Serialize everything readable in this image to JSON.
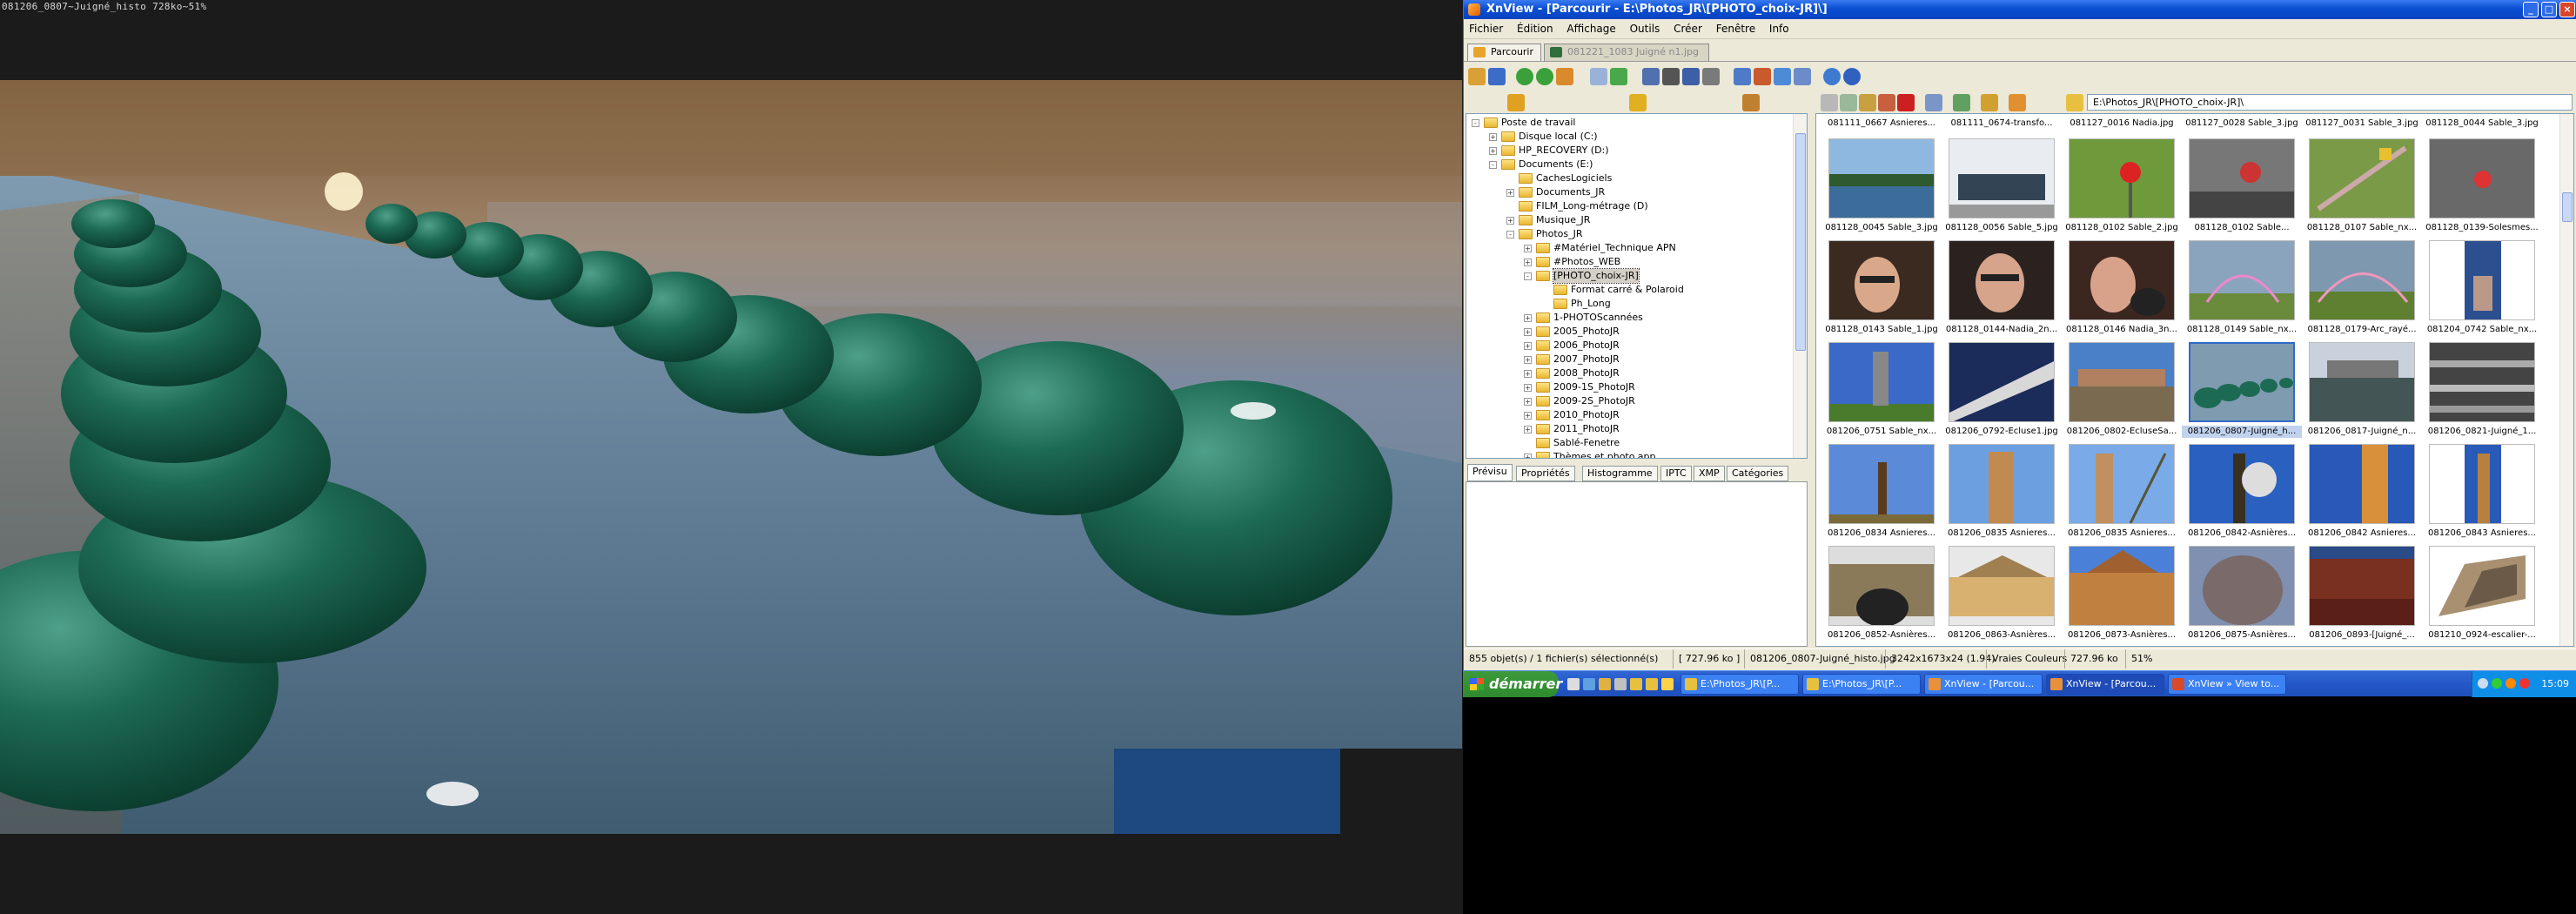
{
  "viewer": {
    "title": "081206_0807~Juigné_histo 728ko~51%"
  },
  "window": {
    "title": "XnView - [Parcourir - E:\\Photos_JR\\[PHOTO_choix-JR]\\]"
  },
  "menu": [
    "Fichier",
    "Édition",
    "Affichage",
    "Outils",
    "Créer",
    "Fenêtre",
    "Info"
  ],
  "tabs": [
    {
      "label": "Parcourir",
      "active": true
    },
    {
      "label": "081221_1083 Juigné n1.jpg",
      "active": false
    }
  ],
  "address": "E:\\Photos_JR\\[PHOTO_choix-JR]\\",
  "folders": [
    {
      "label": "Poste de travail",
      "level": 0,
      "exp": "-"
    },
    {
      "label": "Disque local (C:)",
      "level": 1,
      "exp": "+"
    },
    {
      "label": "HP_RECOVERY (D:)",
      "level": 1,
      "exp": "+"
    },
    {
      "label": "Documents (E:)",
      "level": 1,
      "exp": "-"
    },
    {
      "label": "CachesLogiciels",
      "level": 2,
      "exp": ""
    },
    {
      "label": "Documents_JR",
      "level": 2,
      "exp": "+"
    },
    {
      "label": "FILM_Long-métrage (D)",
      "level": 2,
      "exp": ""
    },
    {
      "label": "Musique_JR",
      "level": 2,
      "exp": "+"
    },
    {
      "label": "Photos_JR",
      "level": 2,
      "exp": "-"
    },
    {
      "label": "#Matériel_Technique APN",
      "level": 3,
      "exp": "+"
    },
    {
      "label": "#Photos_WEB",
      "level": 3,
      "exp": "+"
    },
    {
      "label": "[PHOTO_choix-JR]",
      "level": 3,
      "exp": "-",
      "selected": true
    },
    {
      "label": "Format carré & Polaroid",
      "level": 4,
      "exp": ""
    },
    {
      "label": "Ph_Long",
      "level": 4,
      "exp": ""
    },
    {
      "label": "1-PHOTOScannées",
      "level": 3,
      "exp": "+"
    },
    {
      "label": "2005_PhotoJR",
      "level": 3,
      "exp": "+"
    },
    {
      "label": "2006_PhotoJR",
      "level": 3,
      "exp": "+"
    },
    {
      "label": "2007_PhotoJR",
      "level": 3,
      "exp": "+"
    },
    {
      "label": "2008_PhotoJR",
      "level": 3,
      "exp": "+"
    },
    {
      "label": "2009-1S_PhotoJR",
      "level": 3,
      "exp": "+"
    },
    {
      "label": "2009-2S_PhotoJR",
      "level": 3,
      "exp": "+"
    },
    {
      "label": "2010_PhotoJR",
      "level": 3,
      "exp": "+"
    },
    {
      "label": "2011_PhotoJR",
      "level": 3,
      "exp": "+"
    },
    {
      "label": "Sablé-Fenetre",
      "level": 3,
      "exp": ""
    },
    {
      "label": "Thèmes et photo.app",
      "level": 3,
      "exp": "+"
    }
  ],
  "panel_tabs": [
    "Prévisu",
    "Propriétés",
    "Histogramme",
    "IPTC",
    "XMP",
    "Catégories"
  ],
  "top_row": [
    "081111_0667 Asnieres...",
    "081111_0674-transfo...",
    "081127_0016 Nadia.jpg",
    "081127_0028 Sable_3.jpg",
    "081127_0031 Sable_3.jpg",
    "081128_0044 Sable_3.jpg"
  ],
  "thumbnails": [
    {
      "caption": "081128_0045 Sable_3.jpg",
      "kind": "river"
    },
    {
      "caption": "081128_0056 Sable_5.jpg",
      "kind": "car"
    },
    {
      "caption": "081128_0102 Sable_2.jpg",
      "kind": "sign"
    },
    {
      "caption": "081128_0102 Sable...",
      "kind": "bwsign"
    },
    {
      "caption": "081128_0107 Sable_nx...",
      "kind": "bench"
    },
    {
      "caption": "081128_0139-Solesmes...",
      "kind": "bwred"
    },
    {
      "caption": "081128_0143 Sable_1.jpg",
      "kind": "face"
    },
    {
      "caption": "081128_0144-Nadia_2n...",
      "kind": "face2"
    },
    {
      "caption": "081128_0146 Nadia_3n...",
      "kind": "face3"
    },
    {
      "caption": "081128_0149 Sable_nx...",
      "kind": "rainbow"
    },
    {
      "caption": "081128_0179-Arc_rayé...",
      "kind": "rainbow2"
    },
    {
      "caption": "081204_0742 Sable_nx...",
      "kind": "tall"
    },
    {
      "caption": "081206_0751 Sable_nx...",
      "kind": "tower"
    },
    {
      "caption": "081206_0792-Ecluse1.jpg",
      "kind": "diag"
    },
    {
      "caption": "081206_0802-EcluseSa...",
      "kind": "lock"
    },
    {
      "caption": "081206_0807-Juigné_h...",
      "kind": "balls",
      "selected": true
    },
    {
      "caption": "081206_0817-Juigné_n...",
      "kind": "water"
    },
    {
      "caption": "081206_0821-Juigné_1...",
      "kind": "bwwater"
    },
    {
      "caption": "081206_0834 Asnieres...",
      "kind": "tree"
    },
    {
      "caption": "081206_0835 Asnieres...",
      "kind": "column"
    },
    {
      "caption": "081206_0835 Asnieres...",
      "kind": "tree2"
    },
    {
      "caption": "081206_0842-Asnières...",
      "kind": "tree3"
    },
    {
      "caption": "081206_0842 Asnieres...",
      "kind": "column2"
    },
    {
      "caption": "081206_0843 Asnieres...",
      "kind": "column3"
    },
    {
      "caption": "081206_0852-Asnières...",
      "kind": "bridge"
    },
    {
      "caption": "081206_0863-Asnières...",
      "kind": "manor"
    },
    {
      "caption": "081206_0873-Asnières...",
      "kind": "manor2"
    },
    {
      "caption": "081206_0875-Asnières...",
      "kind": "stone"
    },
    {
      "caption": "081206_0893-[Juigné_...",
      "kind": "brick"
    },
    {
      "caption": "081210_0924-escalier-...",
      "kind": "stairs"
    }
  ],
  "status": [
    "855 objet(s) / 1 fichier(s) sélectionné(s)",
    "[ 727.96 ko ]",
    "081206_0807-Juigné_histo.jpg",
    "3242x1673x24 (1.94)",
    "Vraies Couleurs",
    "727.96 ko",
    "51%"
  ],
  "taskbar": {
    "start": "démarrer",
    "tasks": [
      {
        "label": "E:\\Photos_JR\\[P...",
        "active": false
      },
      {
        "label": "E:\\Photos_JR\\[P...",
        "active": false
      },
      {
        "label": "XnView - [Parcou...",
        "active": false
      },
      {
        "label": "XnView - [Parcou...",
        "active": true
      },
      {
        "label": "XnView » View to...",
        "active": false
      }
    ],
    "clock": "15:09"
  }
}
